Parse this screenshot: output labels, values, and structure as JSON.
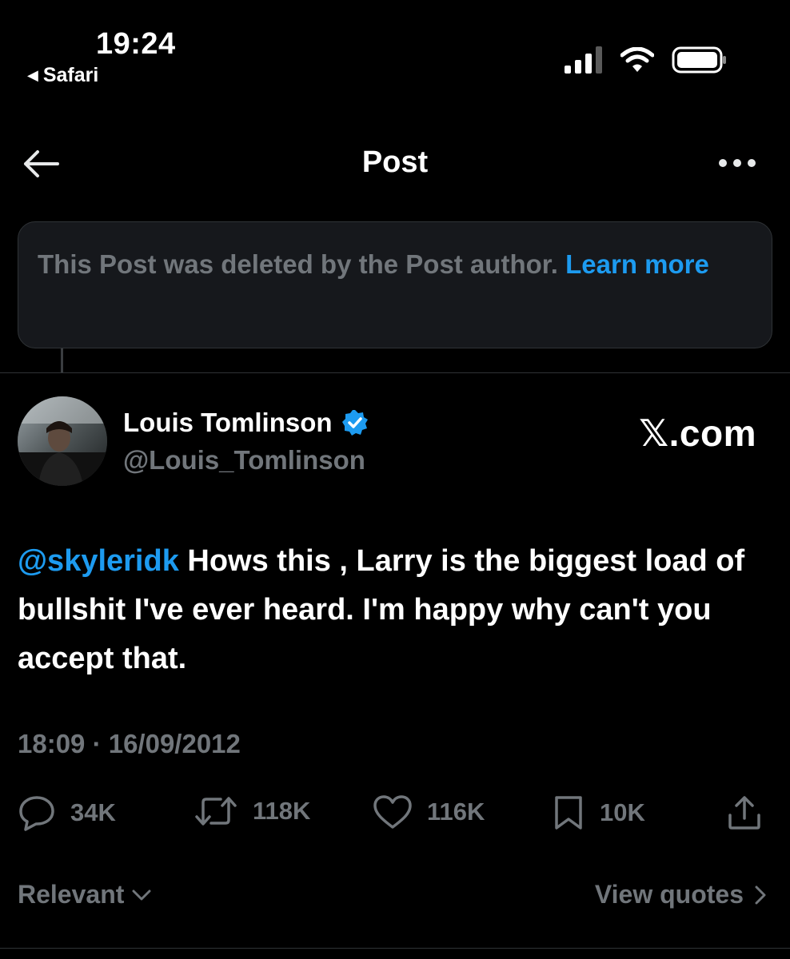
{
  "status_bar": {
    "time": "19:24",
    "back_app": "Safari",
    "icons": [
      "cellular-signal-icon",
      "wifi-icon",
      "battery-icon"
    ]
  },
  "nav": {
    "title": "Post",
    "back_icon": "arrow-left-icon",
    "more_icon": "more-dots-icon"
  },
  "notice": {
    "text": "This Post was deleted by the Post author.",
    "link": "Learn more"
  },
  "author": {
    "name": "Louis Tomlinson",
    "verified": true,
    "handle": "@Louis_Tomlinson",
    "watermark": "𝕏.com"
  },
  "tweet": {
    "mention": "@skyleridk",
    "text": " Hows this , Larry is the biggest load of bullshit I've ever heard. I'm happy why can't you accept that.",
    "timestamp": "18:09 · 16/09/2012"
  },
  "actions": {
    "replies": "34K",
    "reposts": "118K",
    "likes": "116K",
    "bookmarks": "10K"
  },
  "footer": {
    "sort_label": "Relevant",
    "view_quotes": "View quotes"
  },
  "colors": {
    "background": "#000000",
    "accent": "#1d9bf0",
    "muted": "#71767b",
    "notice_bg": "#16181c"
  }
}
